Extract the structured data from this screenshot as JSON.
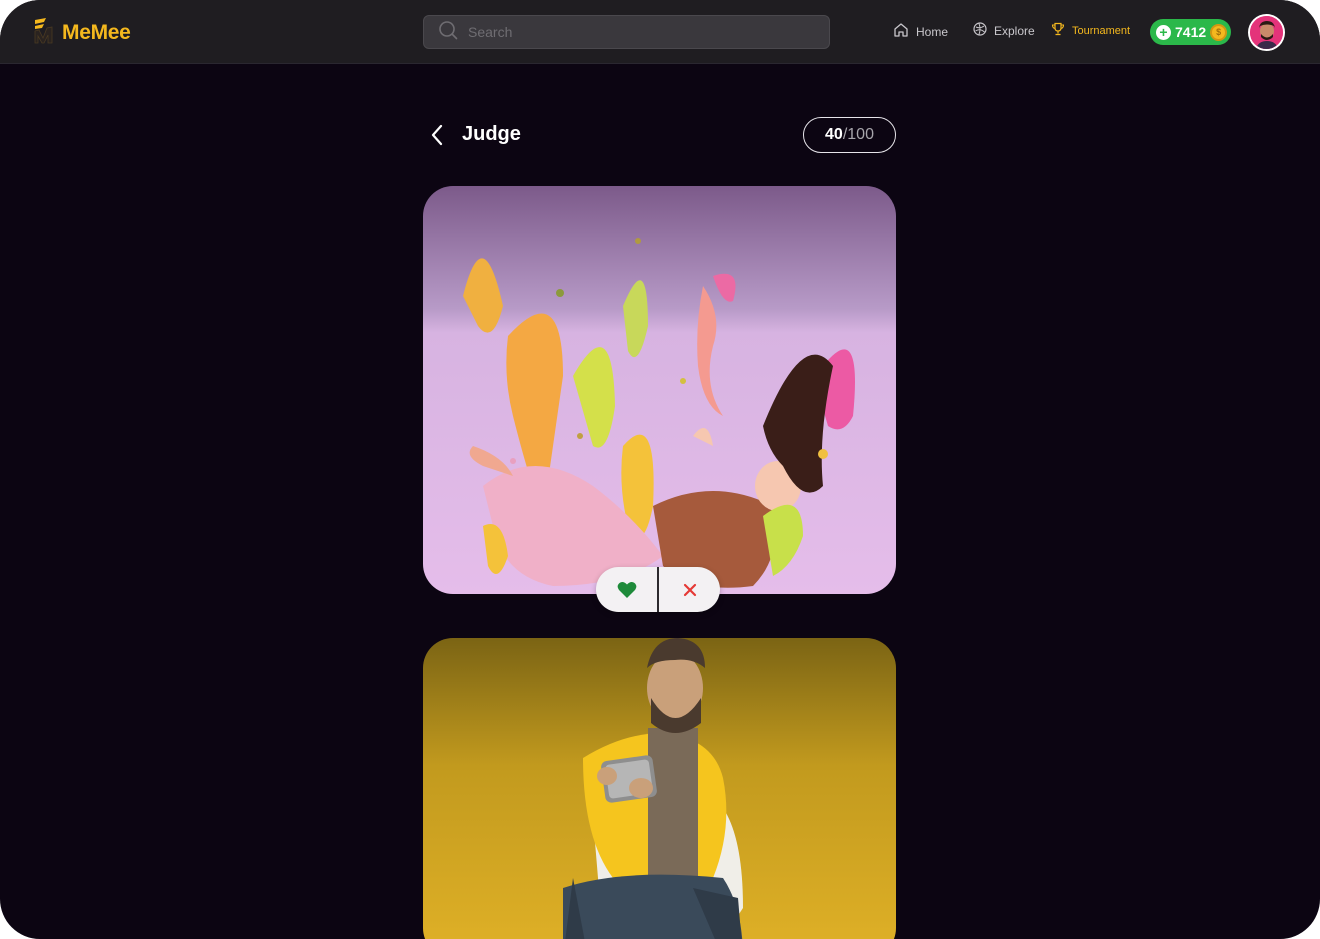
{
  "header": {
    "logo_text": "MeMee",
    "search_placeholder": "Search",
    "nav": [
      {
        "label": "Home",
        "icon": "home-icon"
      },
      {
        "label": "Explore",
        "icon": "explore-icon"
      },
      {
        "label": "Tournament",
        "icon": "trophy-icon"
      }
    ],
    "coins": "7412"
  },
  "judge": {
    "title": "Judge",
    "progress_current": "40",
    "progress_separator": "/",
    "progress_total": "100"
  },
  "colors": {
    "accent": "#f4b81e",
    "coin_badge": "#2bb84a",
    "like": "#1e8a3a",
    "dislike": "#e53935",
    "background": "#0c0512"
  }
}
